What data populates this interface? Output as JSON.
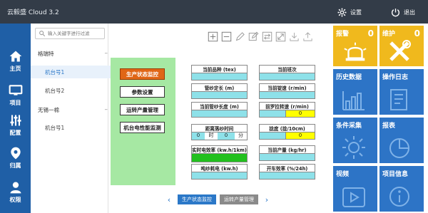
{
  "app": {
    "title": "云毅盛 Cloud 3.2",
    "settings_label": "设置",
    "logout_label": "退出"
  },
  "nav": [
    {
      "label": "主页",
      "icon": "home-icon"
    },
    {
      "label": "项目",
      "icon": "monitor-icon"
    },
    {
      "label": "配置",
      "icon": "sliders-icon"
    },
    {
      "label": "归属",
      "icon": "location-pin-icon"
    },
    {
      "label": "权限",
      "icon": "user-icon"
    }
  ],
  "tree": {
    "search_placeholder": "输入关键字进行过滤",
    "groups": [
      {
        "name": "格瑞特",
        "children": [
          "机台号1",
          "机台号2"
        ]
      },
      {
        "name": "无锡一棉",
        "children": [
          "机台号1"
        ]
      }
    ],
    "selected": "机台号1"
  },
  "toolbar": [
    "zoom-in-icon",
    "zoom-out-icon",
    "edit-icon",
    "edit-box-icon",
    "swap-icon",
    "fullscreen-icon",
    "download-icon",
    "share-icon"
  ],
  "monitor_menu": [
    "生产状态监控",
    "参数设置",
    "运转产量管理",
    "机台电性能监测"
  ],
  "monitor_active": "生产状态监控",
  "fields": {
    "variety": "当前品种 (tex)",
    "shift": "当前班次",
    "tube_length": "管纱定长 (m)",
    "speed": "当前锭速 (r/min)",
    "tube_current": "当前管纱长度 (m)",
    "front_roller": "前罗拉转速 (r/min)",
    "front_roller_value": "0",
    "offline_time": "距离落纱时间",
    "time_values": [
      "0",
      "0"
    ],
    "time_units": [
      "时",
      "分"
    ],
    "twist": "捻度 (捻/10cm)",
    "twist_value": "0",
    "power_efficiency": "实时电效率 (kw.h/1km)",
    "current_output": "当前产量 (kg/hr)",
    "ton_yarn": "吨纱耗电 (kw.h)",
    "open_efficiency": "开车效率 (%/24h)"
  },
  "tiles": [
    {
      "label": "报警",
      "count": "0",
      "color": "#f0b91d",
      "icon": "alarm-light-icon"
    },
    {
      "label": "维护",
      "count": "0",
      "color": "#f0b91d",
      "icon": "tools-icon"
    },
    {
      "label": "历史数据",
      "color": "#2d74c6",
      "icon": "chart-icon"
    },
    {
      "label": "操作日志",
      "color": "#2d74c6",
      "icon": "document-icon"
    },
    {
      "label": "条件采集",
      "color": "#2d74c6",
      "icon": "sun-icon"
    },
    {
      "label": "报表",
      "color": "#2d74c6",
      "icon": "pie-chart-icon"
    },
    {
      "label": "视频",
      "color": "#2d74c6",
      "icon": "play-icon"
    },
    {
      "label": "项目信息",
      "color": "#2d74c6",
      "icon": "info-icon"
    }
  ],
  "bottom_tabs": [
    {
      "label": "生产状态监控",
      "color": "#2b78c8"
    },
    {
      "label": "运转产量管理",
      "color": "#8a8a8a"
    }
  ]
}
